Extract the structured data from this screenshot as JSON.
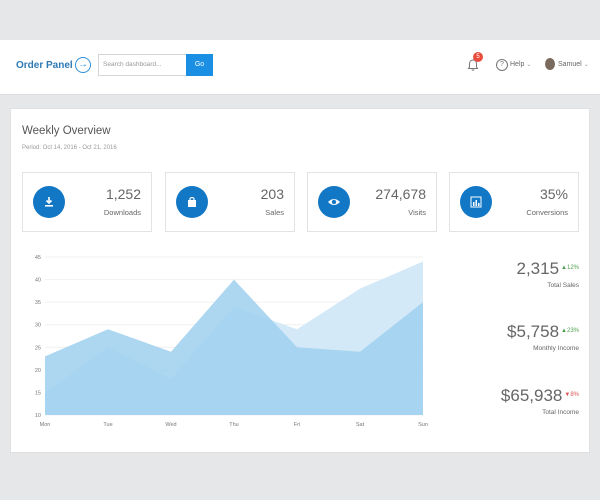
{
  "header": {
    "brand": "Order Panel",
    "search_placeholder": "Search dashboard...",
    "go_label": "Go",
    "notifications_count": "5",
    "help_label": "Help",
    "user_name": "Samuel"
  },
  "overview": {
    "title": "Weekly Overview",
    "period": "Period: Oct 14, 2016 - Oct 21, 2016"
  },
  "stats": [
    {
      "value": "1,252",
      "label": "Downloads",
      "icon": "download-icon"
    },
    {
      "value": "203",
      "label": "Sales",
      "icon": "shopping-bag-icon"
    },
    {
      "value": "274,678",
      "label": "Visits",
      "icon": "eye-icon"
    },
    {
      "value": "35%",
      "label": "Conversions",
      "icon": "bar-chart-icon"
    }
  ],
  "kpis": [
    {
      "value": "2,315",
      "delta": "12%",
      "direction": "up",
      "label": "Total Sales"
    },
    {
      "value": "$5,758",
      "delta": "23%",
      "direction": "up",
      "label": "Monthly Income"
    },
    {
      "value": "$65,938",
      "delta": "8%",
      "direction": "down",
      "label": "Total Income"
    }
  ],
  "chart_data": {
    "type": "area",
    "categories": [
      "Mon",
      "Tue",
      "Wed",
      "Thu",
      "Fri",
      "Sat",
      "Sun"
    ],
    "yticks": [
      10,
      15,
      20,
      25,
      30,
      35,
      40,
      45
    ],
    "ylim": [
      10,
      45
    ],
    "series": [
      {
        "values": [
          15,
          25,
          18,
          34,
          29,
          38,
          44
        ],
        "color": "#cfe7f7"
      },
      {
        "values": [
          23,
          29,
          24,
          40,
          25,
          24,
          35
        ],
        "color": "#9fd0ef"
      }
    ],
    "grid": true,
    "legend": "none"
  },
  "colors": {
    "accent": "#1a8fe3",
    "icon_bg": "#1277c4",
    "badge": "#e74c3c",
    "positive": "#4ea04e",
    "negative": "#d9534f"
  }
}
